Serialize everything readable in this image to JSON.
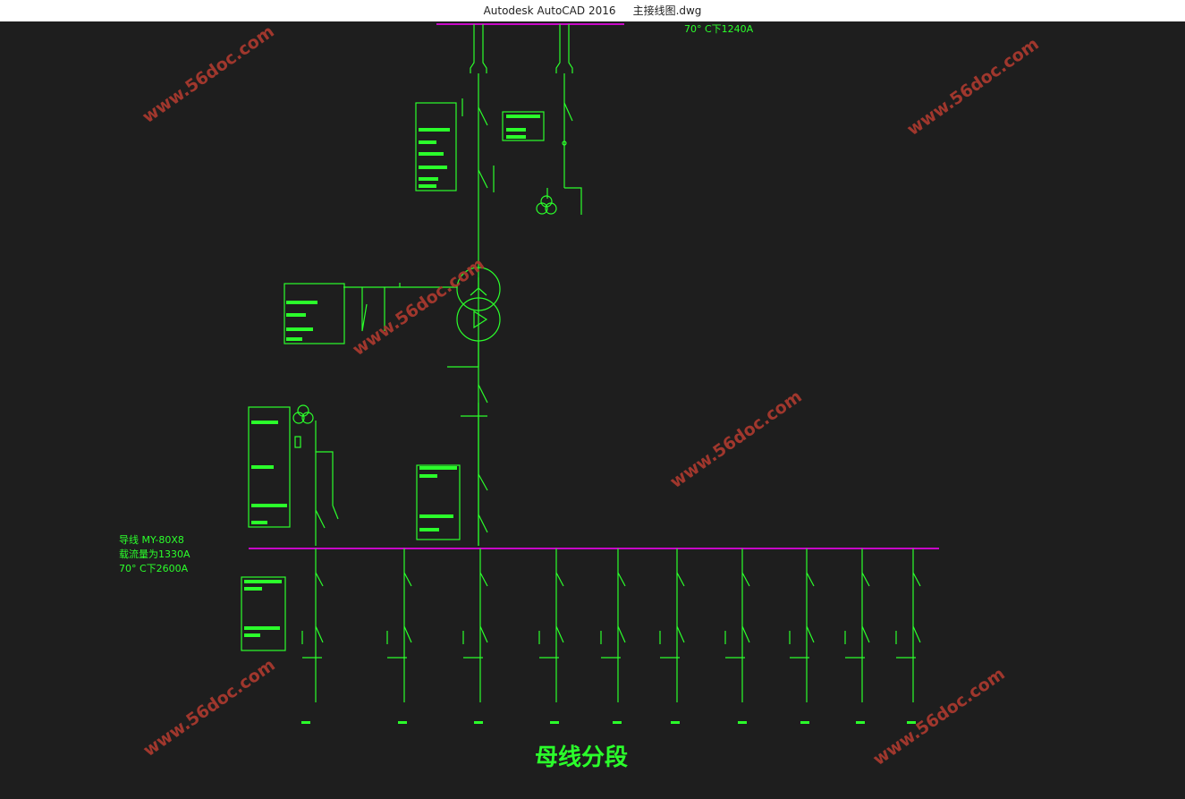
{
  "window": {
    "app_title": "Autodesk AutoCAD 2016",
    "file_name": "主接线图.dwg"
  },
  "drawing": {
    "top_label": "70° C下1240A",
    "bus_info": {
      "line1": "导线 MY-80X8",
      "line2": "载流量为1330A",
      "line3": "70° C下2600A"
    },
    "caption": "母线分段",
    "watermark": "www.56doc.com",
    "colors": {
      "background": "#1e1e1e",
      "line": "#2bff2b",
      "busbar": "#ff00ff",
      "watermark": "#a8392e"
    }
  }
}
